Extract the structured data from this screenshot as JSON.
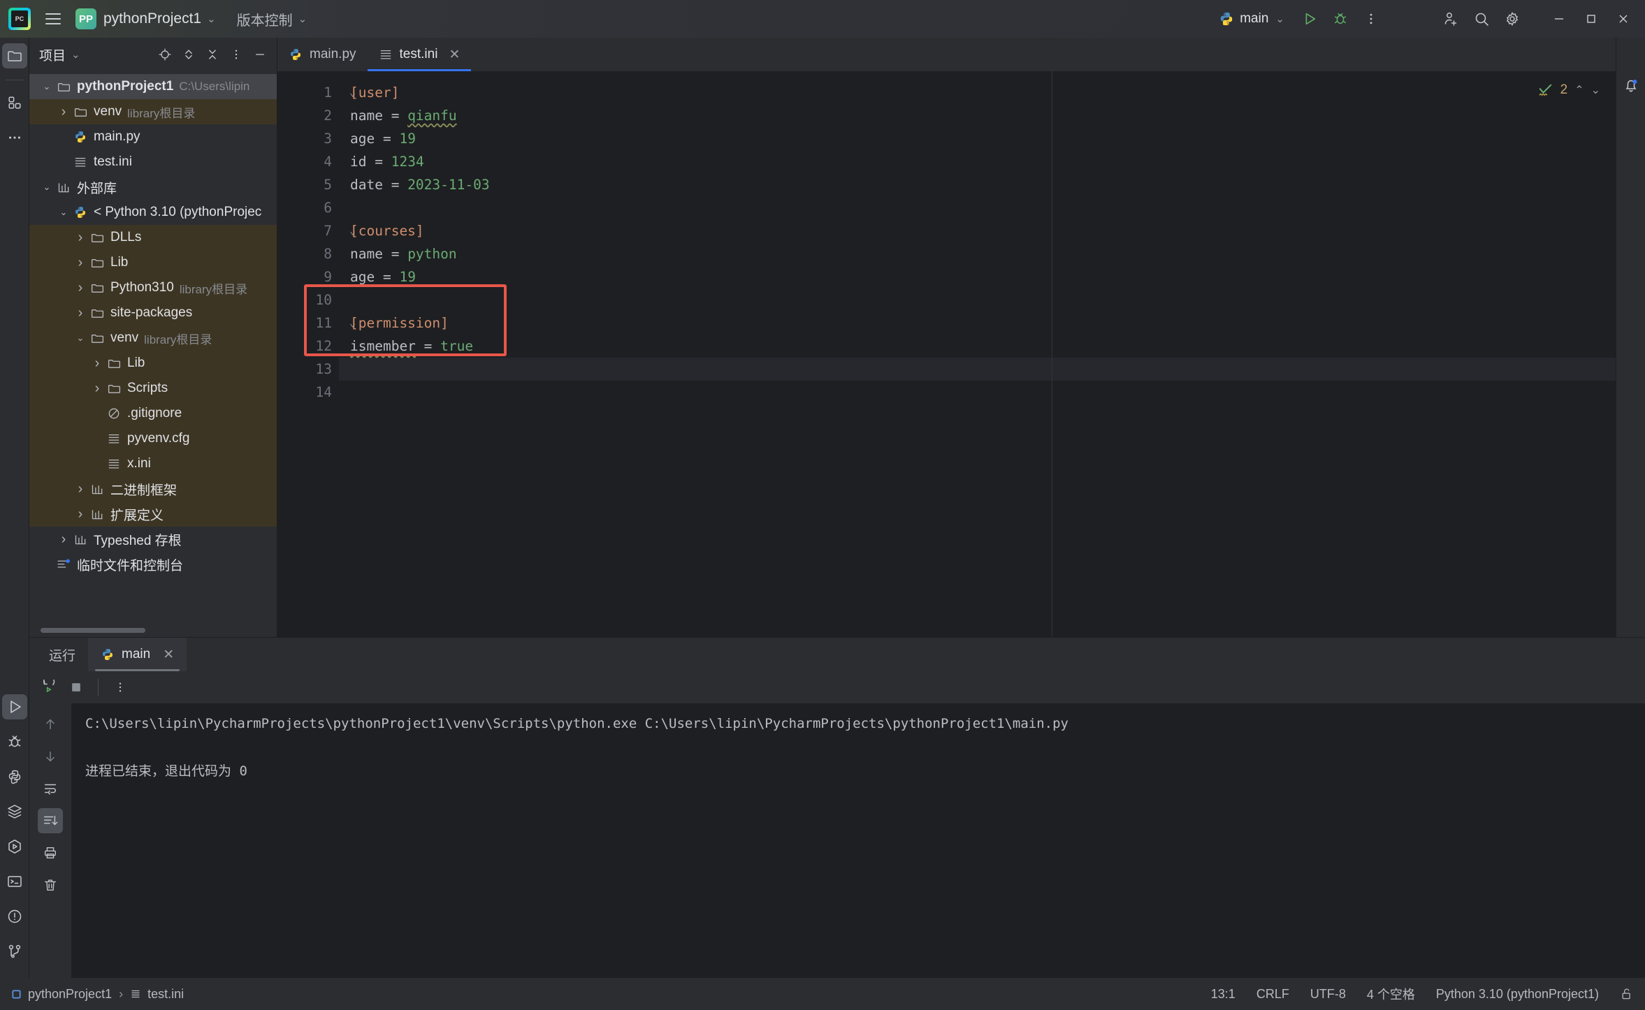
{
  "titlebar": {
    "menu_icon": "hamburger-menu-icon",
    "project_badge": "PP",
    "project_name": "pythonProject1",
    "vcs_label": "版本控制",
    "run_config": "main",
    "icons": {
      "run": "run-icon",
      "debug": "debug-icon",
      "more": "more-vertical-icon",
      "add_user": "add-user-icon",
      "search": "search-icon",
      "settings": "gear-icon",
      "minimize": "minimize-icon",
      "maximize": "maximize-icon",
      "close": "close-icon"
    }
  },
  "rail": {
    "top": [
      {
        "name": "project-tool-window",
        "icon": "folder-icon",
        "active": true
      },
      {
        "name": "structure-tool-window",
        "icon": "grid-icon",
        "active": false
      },
      {
        "name": "more-tool-windows",
        "icon": "ellipsis-icon",
        "active": false
      }
    ],
    "bottom": [
      {
        "name": "run-tool-window",
        "icon": "run-icon",
        "active": true
      },
      {
        "name": "debug-tool-window",
        "icon": "bug-icon",
        "active": false
      },
      {
        "name": "python-packages-tool-window",
        "icon": "python-icon",
        "active": false
      },
      {
        "name": "services-tool-window",
        "icon": "layers-icon",
        "active": false
      },
      {
        "name": "python-console-tool-window",
        "icon": "hex-run-icon",
        "active": false
      },
      {
        "name": "terminal-tool-window",
        "icon": "terminal-icon",
        "active": false
      },
      {
        "name": "problems-tool-window",
        "icon": "warning-circle-icon",
        "active": false
      },
      {
        "name": "version-control-tool-window",
        "icon": "branch-icon",
        "active": false
      }
    ]
  },
  "project_panel": {
    "title": "项目",
    "header_icons": [
      "locate-icon",
      "expand-collapse-icon",
      "collapse-all-icon",
      "options-icon",
      "hide-icon"
    ],
    "tree": [
      {
        "indent": 0,
        "arrow": "down",
        "icon": "folder-icon",
        "label": "pythonProject1",
        "sub": "C:\\Users\\lipin",
        "bold": true,
        "state": "selected"
      },
      {
        "indent": 1,
        "arrow": "right",
        "icon": "folder-icon",
        "label": "venv",
        "sub": "library根目录",
        "bold": false,
        "state": "library"
      },
      {
        "indent": 1,
        "arrow": "none",
        "icon": "python-icon",
        "label": "main.py",
        "sub": "",
        "bold": false,
        "state": "normal"
      },
      {
        "indent": 1,
        "arrow": "none",
        "icon": "ini-icon",
        "label": "test.ini",
        "sub": "",
        "bold": false,
        "state": "normal"
      },
      {
        "indent": 0,
        "arrow": "down",
        "icon": "library-icon",
        "label": "外部库",
        "sub": "",
        "bold": false,
        "state": "normal"
      },
      {
        "indent": 1,
        "arrow": "down",
        "icon": "python-icon",
        "label": "< Python 3.10 (pythonProjec",
        "sub": "",
        "bold": false,
        "state": "normal"
      },
      {
        "indent": 2,
        "arrow": "right",
        "icon": "folder-icon",
        "label": "DLLs",
        "sub": "",
        "bold": false,
        "state": "library"
      },
      {
        "indent": 2,
        "arrow": "right",
        "icon": "folder-icon",
        "label": "Lib",
        "sub": "",
        "bold": false,
        "state": "library"
      },
      {
        "indent": 2,
        "arrow": "right",
        "icon": "folder-icon",
        "label": "Python310",
        "sub": "library根目录",
        "bold": false,
        "state": "library"
      },
      {
        "indent": 2,
        "arrow": "right",
        "icon": "folder-icon",
        "label": "site-packages",
        "sub": "",
        "bold": false,
        "state": "library"
      },
      {
        "indent": 2,
        "arrow": "down",
        "icon": "folder-icon",
        "label": "venv",
        "sub": "library根目录",
        "bold": false,
        "state": "library"
      },
      {
        "indent": 3,
        "arrow": "right",
        "icon": "folder-icon",
        "label": "Lib",
        "sub": "",
        "bold": false,
        "state": "library"
      },
      {
        "indent": 3,
        "arrow": "right",
        "icon": "folder-icon",
        "label": "Scripts",
        "sub": "",
        "bold": false,
        "state": "library"
      },
      {
        "indent": 3,
        "arrow": "none",
        "icon": "gitignore-icon",
        "label": ".gitignore",
        "sub": "",
        "bold": false,
        "state": "library"
      },
      {
        "indent": 3,
        "arrow": "none",
        "icon": "ini-icon",
        "label": "pyvenv.cfg",
        "sub": "",
        "bold": false,
        "state": "library"
      },
      {
        "indent": 3,
        "arrow": "none",
        "icon": "ini-icon",
        "label": "x.ini",
        "sub": "",
        "bold": false,
        "state": "library"
      },
      {
        "indent": 2,
        "arrow": "right",
        "icon": "library-icon",
        "label": "二进制框架",
        "sub": "",
        "bold": false,
        "state": "library"
      },
      {
        "indent": 2,
        "arrow": "right",
        "icon": "library-icon",
        "label": "扩展定义",
        "sub": "",
        "bold": false,
        "state": "library"
      },
      {
        "indent": 1,
        "arrow": "right",
        "icon": "library-icon",
        "label": "Typeshed 存根",
        "sub": "",
        "bold": false,
        "state": "normal"
      },
      {
        "indent": 0,
        "arrow": "none",
        "icon": "scratches-icon",
        "label": "临时文件和控制台",
        "sub": "",
        "bold": false,
        "state": "normal"
      }
    ]
  },
  "editor": {
    "tabs": [
      {
        "label": "main.py",
        "icon": "python-icon",
        "active": false,
        "closable": false
      },
      {
        "label": "test.ini",
        "icon": "ini-icon",
        "active": true,
        "closable": true
      }
    ],
    "inspection": {
      "icon": "inspection-check-icon",
      "count": "2",
      "up": "▲",
      "down": "▼"
    },
    "annotation_box": {
      "color": "#e8564a",
      "covers_lines": "10-13"
    },
    "lines": [
      {
        "no": "1",
        "fold": "down",
        "tokens": [
          {
            "t": "[user]",
            "c": "sec"
          }
        ]
      },
      {
        "no": "2",
        "fold": "",
        "tokens": [
          {
            "t": "name ",
            "c": "key"
          },
          {
            "t": "= ",
            "c": "eq"
          },
          {
            "t": "qianfu",
            "c": "val-typo"
          }
        ]
      },
      {
        "no": "3",
        "fold": "",
        "tokens": [
          {
            "t": "age ",
            "c": "key"
          },
          {
            "t": "= ",
            "c": "eq"
          },
          {
            "t": "19",
            "c": "val"
          }
        ]
      },
      {
        "no": "4",
        "fold": "",
        "tokens": [
          {
            "t": "id ",
            "c": "key"
          },
          {
            "t": "= ",
            "c": "eq"
          },
          {
            "t": "1234",
            "c": "val"
          }
        ]
      },
      {
        "no": "5",
        "fold": "",
        "tokens": [
          {
            "t": "date ",
            "c": "key"
          },
          {
            "t": "= ",
            "c": "eq"
          },
          {
            "t": "2023-11-03",
            "c": "val"
          }
        ]
      },
      {
        "no": "6",
        "fold": "",
        "tokens": []
      },
      {
        "no": "7",
        "fold": "down",
        "tokens": [
          {
            "t": "[courses]",
            "c": "sec"
          }
        ]
      },
      {
        "no": "8",
        "fold": "",
        "tokens": [
          {
            "t": "name ",
            "c": "key"
          },
          {
            "t": "= ",
            "c": "eq"
          },
          {
            "t": "python",
            "c": "val"
          }
        ]
      },
      {
        "no": "9",
        "fold": "",
        "tokens": [
          {
            "t": "age ",
            "c": "key"
          },
          {
            "t": "= ",
            "c": "eq"
          },
          {
            "t": "19",
            "c": "val"
          }
        ]
      },
      {
        "no": "10",
        "fold": "",
        "tokens": []
      },
      {
        "no": "11",
        "fold": "down",
        "tokens": [
          {
            "t": "[permission]",
            "c": "sec"
          }
        ]
      },
      {
        "no": "12",
        "fold": "",
        "tokens": [
          {
            "t": "ismember",
            "c": "key-typo"
          },
          {
            "t": " = ",
            "c": "eq"
          },
          {
            "t": "true",
            "c": "val"
          }
        ]
      },
      {
        "no": "13",
        "fold": "",
        "tokens": [],
        "current": true
      },
      {
        "no": "14",
        "fold": "",
        "tokens": []
      }
    ]
  },
  "run_panel": {
    "tabs": [
      {
        "label": "运行",
        "icon": "",
        "active": false,
        "closable": false
      },
      {
        "label": "main",
        "icon": "python-icon",
        "active": true,
        "closable": true
      }
    ],
    "toolbar": [
      "rerun-icon",
      "stop-icon",
      "more-vertical-icon"
    ],
    "side_icons": [
      "up-arrow-icon",
      "down-arrow-icon",
      "soft-wrap-icon",
      "scroll-to-end-icon",
      "print-icon",
      "trash-icon"
    ],
    "console": {
      "command": "C:\\Users\\lipin\\PycharmProjects\\pythonProject1\\venv\\Scripts\\python.exe C:\\Users\\lipin\\PycharmProjects\\pythonProject1\\main.py",
      "finished": "进程已结束，退出代码为 0"
    }
  },
  "status_bar": {
    "breadcrumb_project": "pythonProject1",
    "breadcrumb_sep": "›",
    "breadcrumb_file": "test.ini",
    "caret": "13:1",
    "line_sep": "CRLF",
    "encoding": "UTF-8",
    "indent": "4 个空格",
    "interpreter": "Python 3.10 (pythonProject1)",
    "lock_icon": "unlocked-icon"
  }
}
